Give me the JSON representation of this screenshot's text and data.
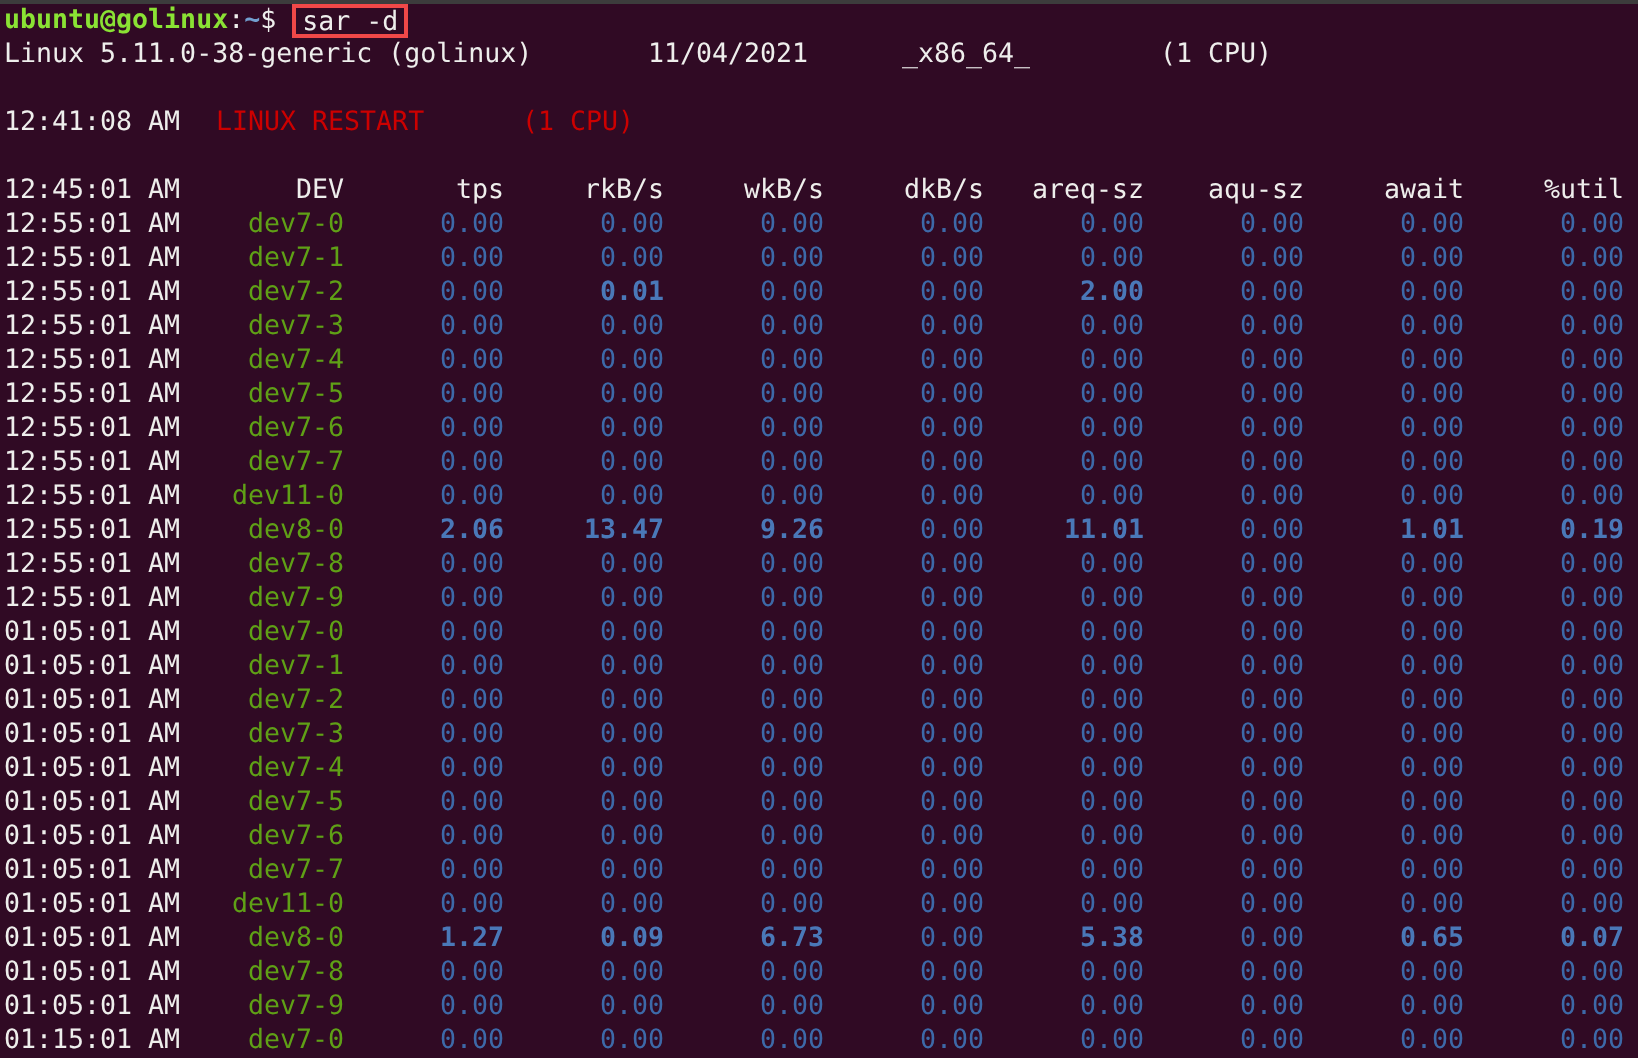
{
  "prompt": {
    "user_host": "ubuntu@golinux",
    "separator": ":",
    "path": "~",
    "symbol": "$",
    "command": "sar -d",
    "highlighted": true
  },
  "system_line": [
    "Linux 5.11.0-38-generic (golinux)",
    "11/04/2021",
    "_x86_64_",
    "(1 CPU)"
  ],
  "restart_line": {
    "time": "12:41:08 AM",
    "event": "LINUX RESTART",
    "cpus": "(1 CPU)"
  },
  "table": {
    "columns": [
      "12:45:01 AM",
      "DEV",
      "tps",
      "rkB/s",
      "wkB/s",
      "dkB/s",
      "areq-sz",
      "aqu-sz",
      "await",
      "%util"
    ],
    "rows": [
      {
        "cells": [
          {
            "value": "12:55:01 AM"
          },
          {
            "value": "dev7-0"
          },
          {
            "value": "0.00",
            "bold": false
          },
          {
            "value": "0.00",
            "bold": false
          },
          {
            "value": "0.00",
            "bold": false
          },
          {
            "value": "0.00",
            "bold": false
          },
          {
            "value": "0.00",
            "bold": false
          },
          {
            "value": "0.00",
            "bold": false
          },
          {
            "value": "0.00",
            "bold": false
          },
          {
            "value": "0.00",
            "bold": false
          }
        ]
      },
      {
        "cells": [
          {
            "value": "12:55:01 AM"
          },
          {
            "value": "dev7-1"
          },
          {
            "value": "0.00",
            "bold": false
          },
          {
            "value": "0.00",
            "bold": false
          },
          {
            "value": "0.00",
            "bold": false
          },
          {
            "value": "0.00",
            "bold": false
          },
          {
            "value": "0.00",
            "bold": false
          },
          {
            "value": "0.00",
            "bold": false
          },
          {
            "value": "0.00",
            "bold": false
          },
          {
            "value": "0.00",
            "bold": false
          }
        ]
      },
      {
        "cells": [
          {
            "value": "12:55:01 AM"
          },
          {
            "value": "dev7-2"
          },
          {
            "value": "0.00",
            "bold": false
          },
          {
            "value": "0.01",
            "bold": true
          },
          {
            "value": "0.00",
            "bold": false
          },
          {
            "value": "0.00",
            "bold": false
          },
          {
            "value": "2.00",
            "bold": true
          },
          {
            "value": "0.00",
            "bold": false
          },
          {
            "value": "0.00",
            "bold": false
          },
          {
            "value": "0.00",
            "bold": false
          }
        ]
      },
      {
        "cells": [
          {
            "value": "12:55:01 AM"
          },
          {
            "value": "dev7-3"
          },
          {
            "value": "0.00",
            "bold": false
          },
          {
            "value": "0.00",
            "bold": false
          },
          {
            "value": "0.00",
            "bold": false
          },
          {
            "value": "0.00",
            "bold": false
          },
          {
            "value": "0.00",
            "bold": false
          },
          {
            "value": "0.00",
            "bold": false
          },
          {
            "value": "0.00",
            "bold": false
          },
          {
            "value": "0.00",
            "bold": false
          }
        ]
      },
      {
        "cells": [
          {
            "value": "12:55:01 AM"
          },
          {
            "value": "dev7-4"
          },
          {
            "value": "0.00",
            "bold": false
          },
          {
            "value": "0.00",
            "bold": false
          },
          {
            "value": "0.00",
            "bold": false
          },
          {
            "value": "0.00",
            "bold": false
          },
          {
            "value": "0.00",
            "bold": false
          },
          {
            "value": "0.00",
            "bold": false
          },
          {
            "value": "0.00",
            "bold": false
          },
          {
            "value": "0.00",
            "bold": false
          }
        ]
      },
      {
        "cells": [
          {
            "value": "12:55:01 AM"
          },
          {
            "value": "dev7-5"
          },
          {
            "value": "0.00",
            "bold": false
          },
          {
            "value": "0.00",
            "bold": false
          },
          {
            "value": "0.00",
            "bold": false
          },
          {
            "value": "0.00",
            "bold": false
          },
          {
            "value": "0.00",
            "bold": false
          },
          {
            "value": "0.00",
            "bold": false
          },
          {
            "value": "0.00",
            "bold": false
          },
          {
            "value": "0.00",
            "bold": false
          }
        ]
      },
      {
        "cells": [
          {
            "value": "12:55:01 AM"
          },
          {
            "value": "dev7-6"
          },
          {
            "value": "0.00",
            "bold": false
          },
          {
            "value": "0.00",
            "bold": false
          },
          {
            "value": "0.00",
            "bold": false
          },
          {
            "value": "0.00",
            "bold": false
          },
          {
            "value": "0.00",
            "bold": false
          },
          {
            "value": "0.00",
            "bold": false
          },
          {
            "value": "0.00",
            "bold": false
          },
          {
            "value": "0.00",
            "bold": false
          }
        ]
      },
      {
        "cells": [
          {
            "value": "12:55:01 AM"
          },
          {
            "value": "dev7-7"
          },
          {
            "value": "0.00",
            "bold": false
          },
          {
            "value": "0.00",
            "bold": false
          },
          {
            "value": "0.00",
            "bold": false
          },
          {
            "value": "0.00",
            "bold": false
          },
          {
            "value": "0.00",
            "bold": false
          },
          {
            "value": "0.00",
            "bold": false
          },
          {
            "value": "0.00",
            "bold": false
          },
          {
            "value": "0.00",
            "bold": false
          }
        ]
      },
      {
        "cells": [
          {
            "value": "12:55:01 AM"
          },
          {
            "value": "dev11-0"
          },
          {
            "value": "0.00",
            "bold": false
          },
          {
            "value": "0.00",
            "bold": false
          },
          {
            "value": "0.00",
            "bold": false
          },
          {
            "value": "0.00",
            "bold": false
          },
          {
            "value": "0.00",
            "bold": false
          },
          {
            "value": "0.00",
            "bold": false
          },
          {
            "value": "0.00",
            "bold": false
          },
          {
            "value": "0.00",
            "bold": false
          }
        ]
      },
      {
        "cells": [
          {
            "value": "12:55:01 AM"
          },
          {
            "value": "dev8-0"
          },
          {
            "value": "2.06",
            "bold": true
          },
          {
            "value": "13.47",
            "bold": true
          },
          {
            "value": "9.26",
            "bold": true
          },
          {
            "value": "0.00",
            "bold": false
          },
          {
            "value": "11.01",
            "bold": true
          },
          {
            "value": "0.00",
            "bold": false
          },
          {
            "value": "1.01",
            "bold": true
          },
          {
            "value": "0.19",
            "bold": true
          }
        ]
      },
      {
        "cells": [
          {
            "value": "12:55:01 AM"
          },
          {
            "value": "dev7-8"
          },
          {
            "value": "0.00",
            "bold": false
          },
          {
            "value": "0.00",
            "bold": false
          },
          {
            "value": "0.00",
            "bold": false
          },
          {
            "value": "0.00",
            "bold": false
          },
          {
            "value": "0.00",
            "bold": false
          },
          {
            "value": "0.00",
            "bold": false
          },
          {
            "value": "0.00",
            "bold": false
          },
          {
            "value": "0.00",
            "bold": false
          }
        ]
      },
      {
        "cells": [
          {
            "value": "12:55:01 AM"
          },
          {
            "value": "dev7-9"
          },
          {
            "value": "0.00",
            "bold": false
          },
          {
            "value": "0.00",
            "bold": false
          },
          {
            "value": "0.00",
            "bold": false
          },
          {
            "value": "0.00",
            "bold": false
          },
          {
            "value": "0.00",
            "bold": false
          },
          {
            "value": "0.00",
            "bold": false
          },
          {
            "value": "0.00",
            "bold": false
          },
          {
            "value": "0.00",
            "bold": false
          }
        ]
      },
      {
        "cells": [
          {
            "value": "01:05:01 AM"
          },
          {
            "value": "dev7-0"
          },
          {
            "value": "0.00",
            "bold": false
          },
          {
            "value": "0.00",
            "bold": false
          },
          {
            "value": "0.00",
            "bold": false
          },
          {
            "value": "0.00",
            "bold": false
          },
          {
            "value": "0.00",
            "bold": false
          },
          {
            "value": "0.00",
            "bold": false
          },
          {
            "value": "0.00",
            "bold": false
          },
          {
            "value": "0.00",
            "bold": false
          }
        ]
      },
      {
        "cells": [
          {
            "value": "01:05:01 AM"
          },
          {
            "value": "dev7-1"
          },
          {
            "value": "0.00",
            "bold": false
          },
          {
            "value": "0.00",
            "bold": false
          },
          {
            "value": "0.00",
            "bold": false
          },
          {
            "value": "0.00",
            "bold": false
          },
          {
            "value": "0.00",
            "bold": false
          },
          {
            "value": "0.00",
            "bold": false
          },
          {
            "value": "0.00",
            "bold": false
          },
          {
            "value": "0.00",
            "bold": false
          }
        ]
      },
      {
        "cells": [
          {
            "value": "01:05:01 AM"
          },
          {
            "value": "dev7-2"
          },
          {
            "value": "0.00",
            "bold": false
          },
          {
            "value": "0.00",
            "bold": false
          },
          {
            "value": "0.00",
            "bold": false
          },
          {
            "value": "0.00",
            "bold": false
          },
          {
            "value": "0.00",
            "bold": false
          },
          {
            "value": "0.00",
            "bold": false
          },
          {
            "value": "0.00",
            "bold": false
          },
          {
            "value": "0.00",
            "bold": false
          }
        ]
      },
      {
        "cells": [
          {
            "value": "01:05:01 AM"
          },
          {
            "value": "dev7-3"
          },
          {
            "value": "0.00",
            "bold": false
          },
          {
            "value": "0.00",
            "bold": false
          },
          {
            "value": "0.00",
            "bold": false
          },
          {
            "value": "0.00",
            "bold": false
          },
          {
            "value": "0.00",
            "bold": false
          },
          {
            "value": "0.00",
            "bold": false
          },
          {
            "value": "0.00",
            "bold": false
          },
          {
            "value": "0.00",
            "bold": false
          }
        ]
      },
      {
        "cells": [
          {
            "value": "01:05:01 AM"
          },
          {
            "value": "dev7-4"
          },
          {
            "value": "0.00",
            "bold": false
          },
          {
            "value": "0.00",
            "bold": false
          },
          {
            "value": "0.00",
            "bold": false
          },
          {
            "value": "0.00",
            "bold": false
          },
          {
            "value": "0.00",
            "bold": false
          },
          {
            "value": "0.00",
            "bold": false
          },
          {
            "value": "0.00",
            "bold": false
          },
          {
            "value": "0.00",
            "bold": false
          }
        ]
      },
      {
        "cells": [
          {
            "value": "01:05:01 AM"
          },
          {
            "value": "dev7-5"
          },
          {
            "value": "0.00",
            "bold": false
          },
          {
            "value": "0.00",
            "bold": false
          },
          {
            "value": "0.00",
            "bold": false
          },
          {
            "value": "0.00",
            "bold": false
          },
          {
            "value": "0.00",
            "bold": false
          },
          {
            "value": "0.00",
            "bold": false
          },
          {
            "value": "0.00",
            "bold": false
          },
          {
            "value": "0.00",
            "bold": false
          }
        ]
      },
      {
        "cells": [
          {
            "value": "01:05:01 AM"
          },
          {
            "value": "dev7-6"
          },
          {
            "value": "0.00",
            "bold": false
          },
          {
            "value": "0.00",
            "bold": false
          },
          {
            "value": "0.00",
            "bold": false
          },
          {
            "value": "0.00",
            "bold": false
          },
          {
            "value": "0.00",
            "bold": false
          },
          {
            "value": "0.00",
            "bold": false
          },
          {
            "value": "0.00",
            "bold": false
          },
          {
            "value": "0.00",
            "bold": false
          }
        ]
      },
      {
        "cells": [
          {
            "value": "01:05:01 AM"
          },
          {
            "value": "dev7-7"
          },
          {
            "value": "0.00",
            "bold": false
          },
          {
            "value": "0.00",
            "bold": false
          },
          {
            "value": "0.00",
            "bold": false
          },
          {
            "value": "0.00",
            "bold": false
          },
          {
            "value": "0.00",
            "bold": false
          },
          {
            "value": "0.00",
            "bold": false
          },
          {
            "value": "0.00",
            "bold": false
          },
          {
            "value": "0.00",
            "bold": false
          }
        ]
      },
      {
        "cells": [
          {
            "value": "01:05:01 AM"
          },
          {
            "value": "dev11-0"
          },
          {
            "value": "0.00",
            "bold": false
          },
          {
            "value": "0.00",
            "bold": false
          },
          {
            "value": "0.00",
            "bold": false
          },
          {
            "value": "0.00",
            "bold": false
          },
          {
            "value": "0.00",
            "bold": false
          },
          {
            "value": "0.00",
            "bold": false
          },
          {
            "value": "0.00",
            "bold": false
          },
          {
            "value": "0.00",
            "bold": false
          }
        ]
      },
      {
        "cells": [
          {
            "value": "01:05:01 AM"
          },
          {
            "value": "dev8-0"
          },
          {
            "value": "1.27",
            "bold": true
          },
          {
            "value": "0.09",
            "bold": true
          },
          {
            "value": "6.73",
            "bold": true
          },
          {
            "value": "0.00",
            "bold": false
          },
          {
            "value": "5.38",
            "bold": true
          },
          {
            "value": "0.00",
            "bold": false
          },
          {
            "value": "0.65",
            "bold": true
          },
          {
            "value": "0.07",
            "bold": true
          }
        ]
      },
      {
        "cells": [
          {
            "value": "01:05:01 AM"
          },
          {
            "value": "dev7-8"
          },
          {
            "value": "0.00",
            "bold": false
          },
          {
            "value": "0.00",
            "bold": false
          },
          {
            "value": "0.00",
            "bold": false
          },
          {
            "value": "0.00",
            "bold": false
          },
          {
            "value": "0.00",
            "bold": false
          },
          {
            "value": "0.00",
            "bold": false
          },
          {
            "value": "0.00",
            "bold": false
          },
          {
            "value": "0.00",
            "bold": false
          }
        ]
      },
      {
        "cells": [
          {
            "value": "01:05:01 AM"
          },
          {
            "value": "dev7-9"
          },
          {
            "value": "0.00",
            "bold": false
          },
          {
            "value": "0.00",
            "bold": false
          },
          {
            "value": "0.00",
            "bold": false
          },
          {
            "value": "0.00",
            "bold": false
          },
          {
            "value": "0.00",
            "bold": false
          },
          {
            "value": "0.00",
            "bold": false
          },
          {
            "value": "0.00",
            "bold": false
          },
          {
            "value": "0.00",
            "bold": false
          }
        ]
      },
      {
        "cells": [
          {
            "value": "01:15:01 AM"
          },
          {
            "value": "dev7-0"
          },
          {
            "value": "0.00",
            "bold": false
          },
          {
            "value": "0.00",
            "bold": false
          },
          {
            "value": "0.00",
            "bold": false
          },
          {
            "value": "0.00",
            "bold": false
          },
          {
            "value": "0.00",
            "bold": false
          },
          {
            "value": "0.00",
            "bold": false
          },
          {
            "value": "0.00",
            "bold": false
          },
          {
            "value": "0.00",
            "bold": false
          }
        ]
      }
    ]
  }
}
